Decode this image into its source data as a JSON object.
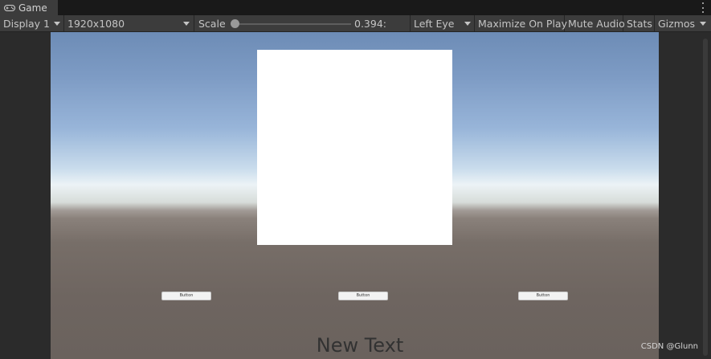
{
  "tab": {
    "icon": "gamepad-icon",
    "label": "Game"
  },
  "toolbar": {
    "display": "Display 1",
    "resolution": "1920x1080",
    "scale_label": "Scale",
    "scale_value": "0.394:",
    "eye": "Left Eye",
    "maximize": "Maximize On Play",
    "mute": "Mute Audio",
    "stats": "Stats",
    "gizmos": "Gizmos"
  },
  "game_view": {
    "buttons": [
      "Button",
      "Button",
      "Button"
    ],
    "text": "New Text"
  },
  "watermark": "CSDN @Glunn"
}
